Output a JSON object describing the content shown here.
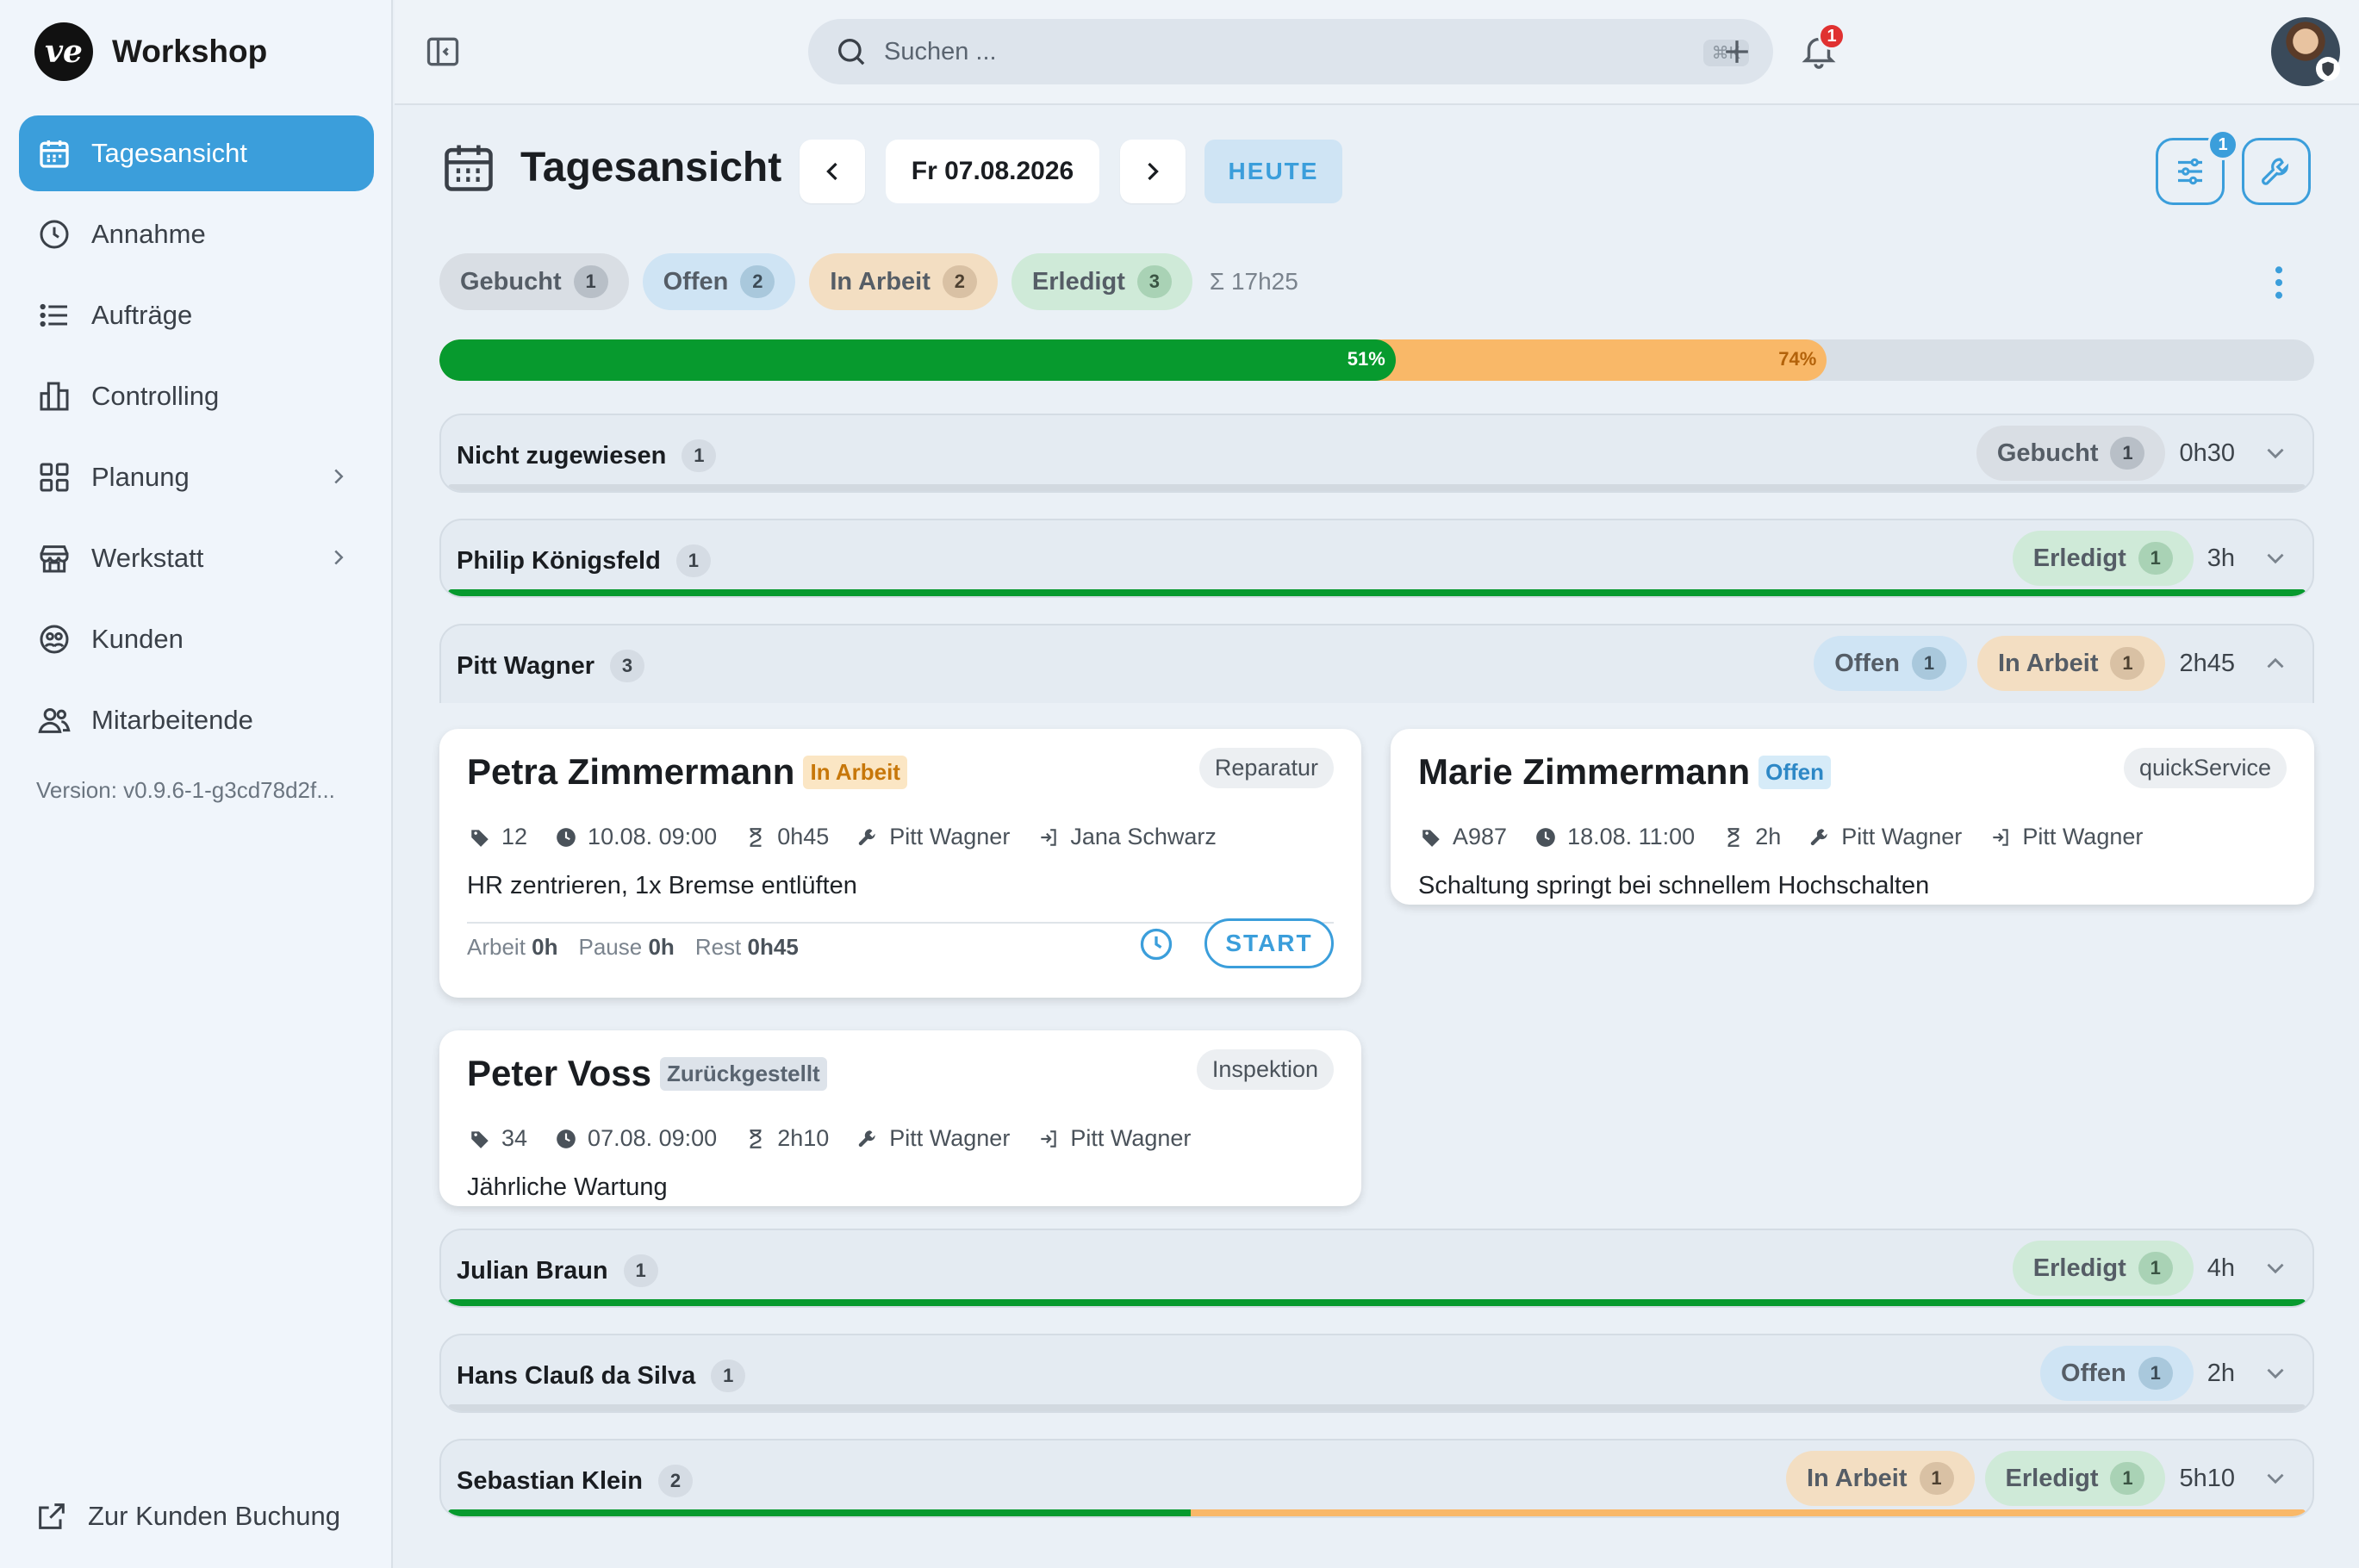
{
  "brand": {
    "name": "Workshop",
    "logo_text": "ve"
  },
  "sidebar": {
    "items": [
      {
        "label": "Tagesansicht",
        "icon": "calendar-icon",
        "active": true
      },
      {
        "label": "Annahme",
        "icon": "clock-icon"
      },
      {
        "label": "Aufträge",
        "icon": "list-icon"
      },
      {
        "label": "Controlling",
        "icon": "building-chart-icon"
      },
      {
        "label": "Planung",
        "icon": "grid-icon",
        "has_submenu": true
      },
      {
        "label": "Werkstatt",
        "icon": "store-icon",
        "has_submenu": true
      },
      {
        "label": "Kunden",
        "icon": "customers-icon"
      },
      {
        "label": "Mitarbeitende",
        "icon": "users-icon"
      }
    ],
    "version": "Version: v0.9.6-1-g3cd78d2f...",
    "customer_booking_label": "Zur Kunden Buchung"
  },
  "topbar": {
    "search_placeholder": "Suchen ...",
    "search_shortcut": "⌘K",
    "notification_count": "1"
  },
  "header": {
    "title": "Tagesansicht",
    "date": "Fr 07.08.2026",
    "today_label": "HEUTE",
    "filter_badge": "1"
  },
  "summary": {
    "pills": [
      {
        "label": "Gebucht",
        "count": "1",
        "status": "gebucht"
      },
      {
        "label": "Offen",
        "count": "2",
        "status": "offen"
      },
      {
        "label": "In Arbeit",
        "count": "2",
        "status": "inarbeit"
      },
      {
        "label": "Erledigt",
        "count": "3",
        "status": "erledigt"
      }
    ],
    "total": "Σ 17h25"
  },
  "progress": {
    "done_percent": 51,
    "done_label": "51%",
    "active_percent": 74,
    "active_label": "74%"
  },
  "colors": {
    "accent": "#3b9edb",
    "done": "#079a2e",
    "in_progress": "#f9b868"
  },
  "groups": [
    {
      "name": "Nicht zugewiesen",
      "count": "1",
      "badges": [
        {
          "label": "Gebucht",
          "count": "1",
          "status": "gebucht"
        }
      ],
      "duration": "0h30",
      "expanded": false,
      "bar": []
    },
    {
      "name": "Philip Königsfeld",
      "count": "1",
      "badges": [
        {
          "label": "Erledigt",
          "count": "1",
          "status": "erledigt"
        }
      ],
      "duration": "3h",
      "expanded": false,
      "bar": [
        {
          "status": "done",
          "fraction": 1.0
        }
      ]
    },
    {
      "name": "Pitt Wagner",
      "count": "3",
      "badges": [
        {
          "label": "Offen",
          "count": "1",
          "status": "offen"
        },
        {
          "label": "In Arbeit",
          "count": "1",
          "status": "inarbeit"
        }
      ],
      "duration": "2h45",
      "expanded": true,
      "bar": []
    },
    {
      "name": "Julian Braun",
      "count": "1",
      "badges": [
        {
          "label": "Erledigt",
          "count": "1",
          "status": "erledigt"
        }
      ],
      "duration": "4h",
      "expanded": false,
      "bar": [
        {
          "status": "done",
          "fraction": 1.0
        }
      ]
    },
    {
      "name": "Hans Clauß da Silva",
      "count": "1",
      "badges": [
        {
          "label": "Offen",
          "count": "1",
          "status": "offen"
        }
      ],
      "duration": "2h",
      "expanded": false,
      "bar": []
    },
    {
      "name": "Sebastian Klein",
      "count": "2",
      "badges": [
        {
          "label": "In Arbeit",
          "count": "1",
          "status": "inarbeit"
        },
        {
          "label": "Erledigt",
          "count": "1",
          "status": "erledigt"
        }
      ],
      "duration": "5h10",
      "expanded": false,
      "bar": [
        {
          "status": "done",
          "fraction": 0.4
        },
        {
          "status": "active",
          "fraction": 0.6
        }
      ]
    }
  ],
  "cards": [
    {
      "customer": "Petra Zimmermann",
      "status": "In Arbeit",
      "type": "Reparatur",
      "tag": "12",
      "datetime": "10.08. 09:00",
      "duration": "0h45",
      "mechanic": "Pitt Wagner",
      "assignee": "Jana Schwarz",
      "description": "HR zentrieren, 1x Bremse entlüften",
      "work_label": "Arbeit",
      "work": "0h",
      "pause_label": "Pause",
      "pause": "0h",
      "rest_label": "Rest",
      "rest": "0h45",
      "start_label": "START"
    },
    {
      "customer": "Marie Zimmermann",
      "status": "Offen",
      "type": "quickService",
      "tag": "A987",
      "datetime": "18.08. 11:00",
      "duration": "2h",
      "mechanic": "Pitt Wagner",
      "assignee": "Pitt Wagner",
      "description": "Schaltung springt bei schnellem Hochschalten"
    },
    {
      "customer": "Peter Voss",
      "status": "Zurückgestellt",
      "type": "Inspektion",
      "tag": "34",
      "datetime": "07.08. 09:00",
      "duration": "2h10",
      "mechanic": "Pitt Wagner",
      "assignee": "Pitt Wagner",
      "description": "Jährliche Wartung"
    }
  ]
}
